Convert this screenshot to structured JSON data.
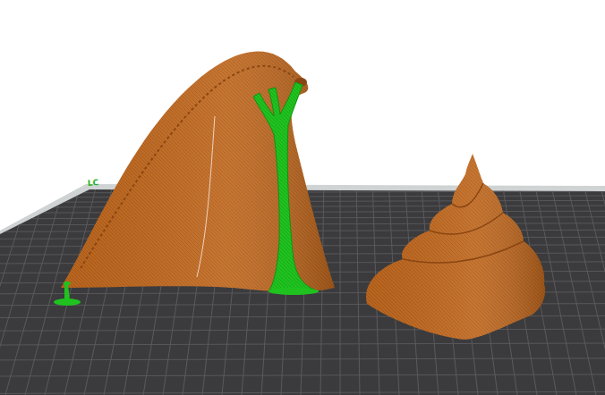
{
  "bed_label": "LC",
  "objects": [
    {
      "kind": "fin",
      "color": "#c2691f"
    },
    {
      "kind": "cone",
      "color": "#c2691f"
    },
    {
      "kind": "support",
      "color": "#1fc21f"
    },
    {
      "kind": "stub",
      "color": "#1fc21f"
    }
  ]
}
